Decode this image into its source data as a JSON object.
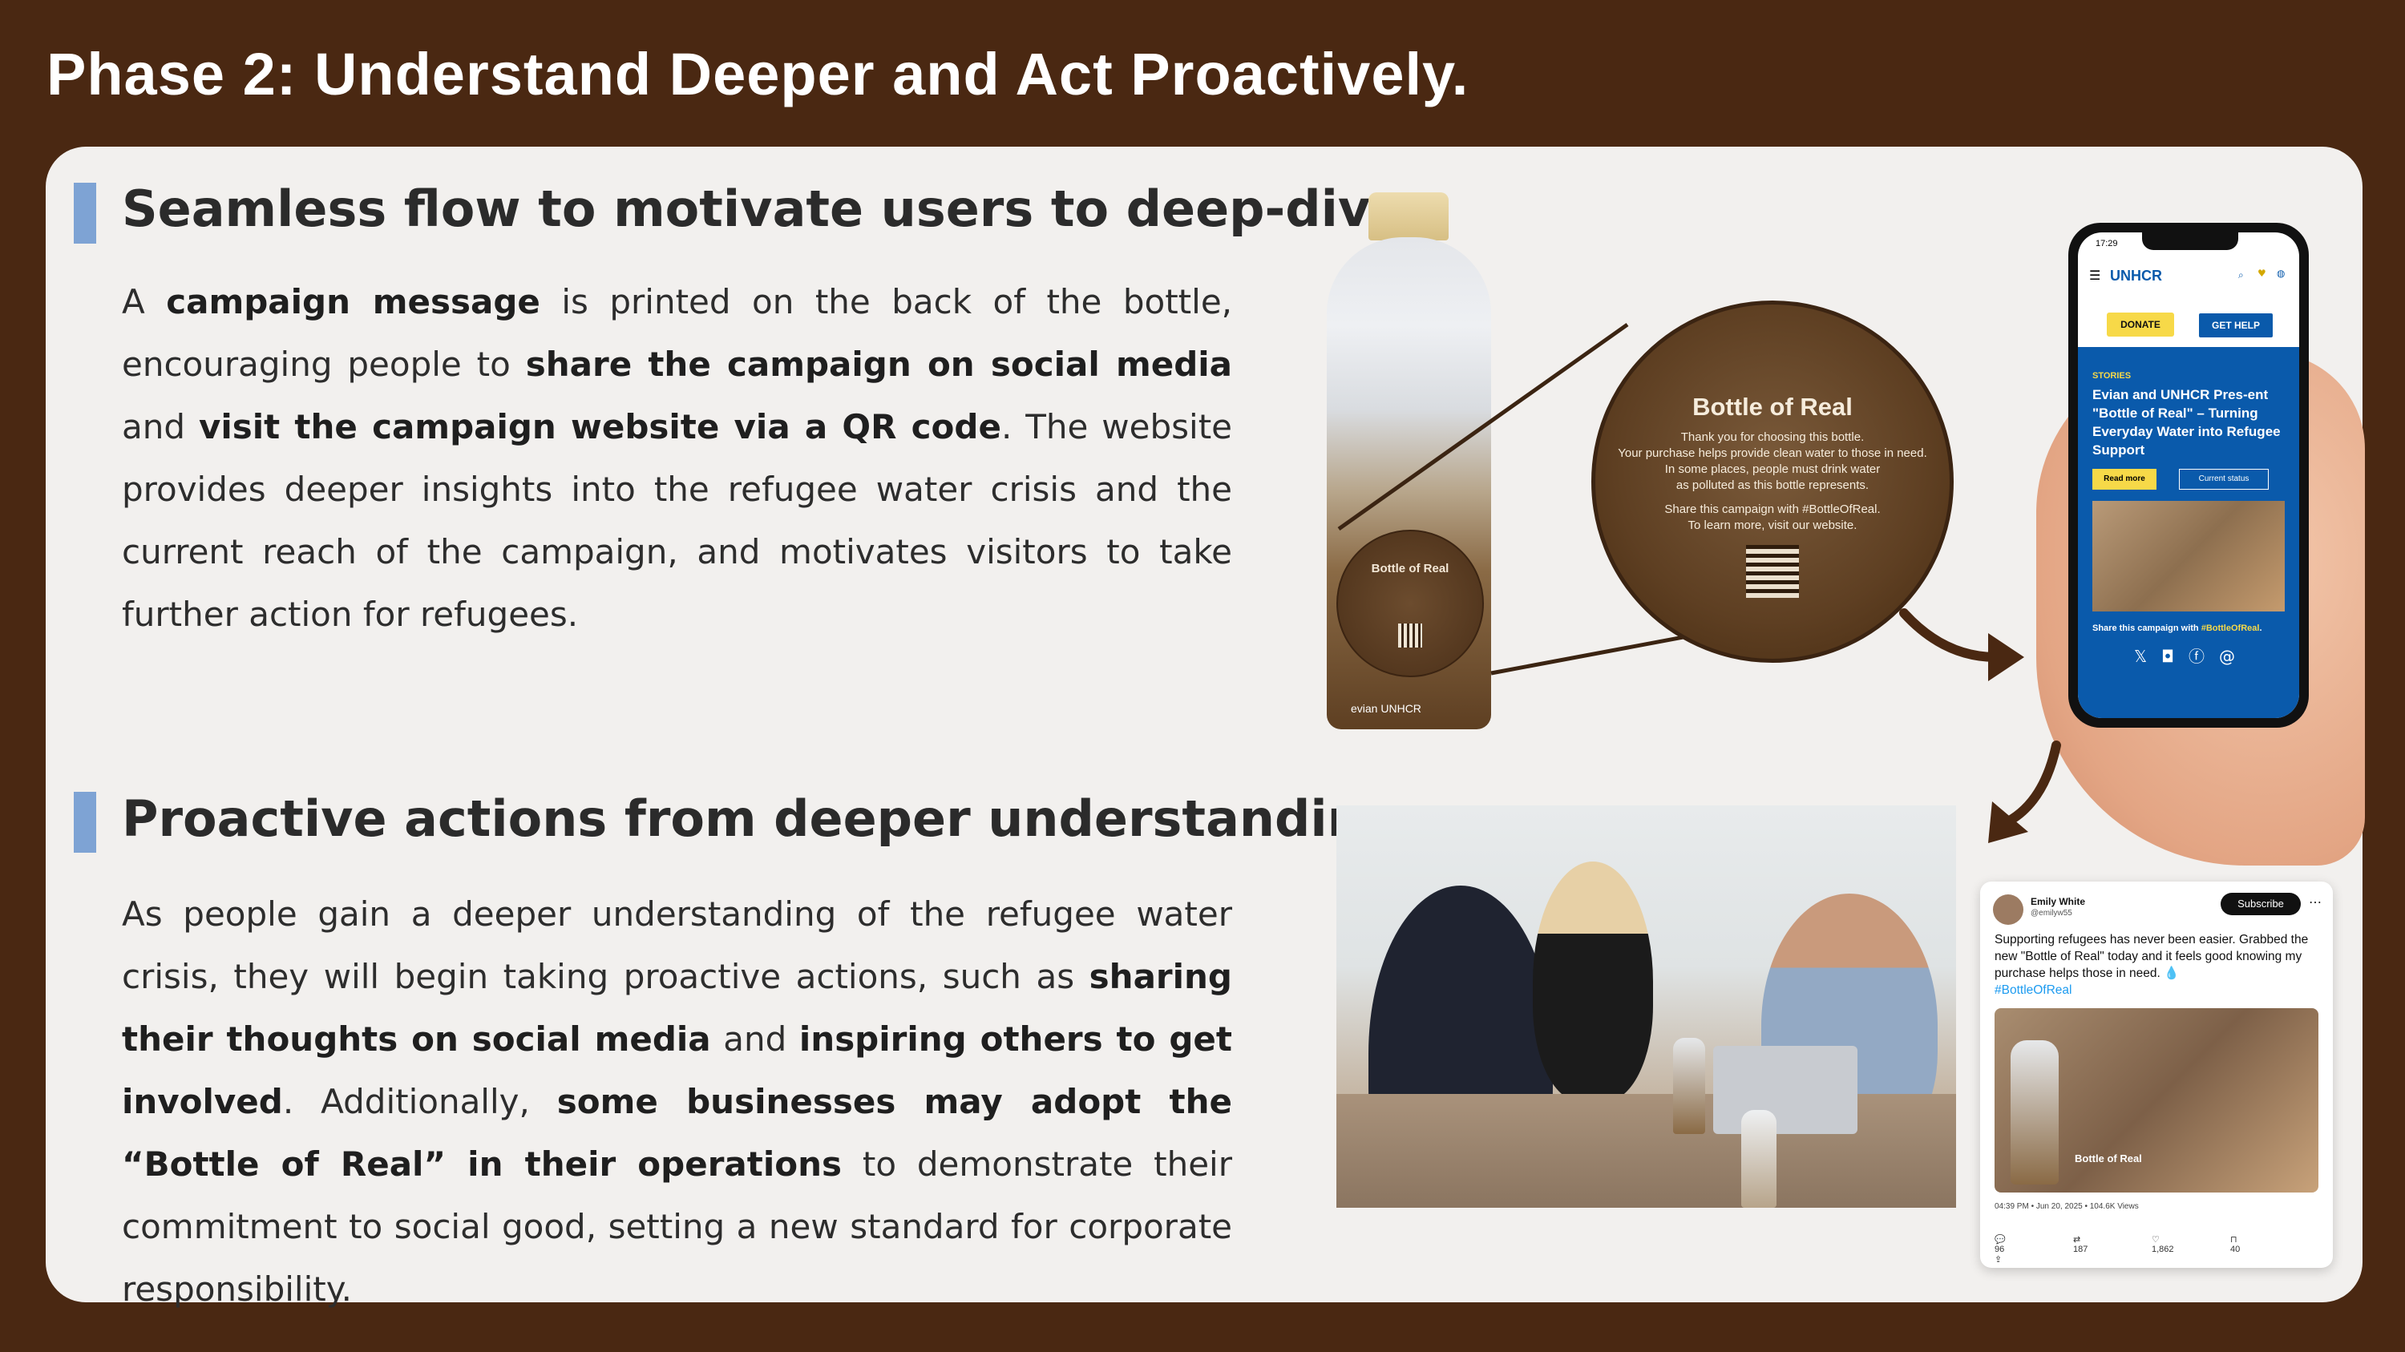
{
  "title": "Phase 2: Understand Deeper and Act Proactively.",
  "section1": {
    "title": "Seamless flow to motivate users to deep-dive",
    "body": [
      {
        "text": "A ",
        "bold": false
      },
      {
        "text": "campaign message",
        "bold": true
      },
      {
        "text": " is printed on the back of the bottle, encouraging people to ",
        "bold": false
      },
      {
        "text": "share the campaign on social media",
        "bold": true
      },
      {
        "text": " and ",
        "bold": false
      },
      {
        "text": "visit the campaign website via a QR code",
        "bold": true
      },
      {
        "text": ". The website provides deeper insights into the refugee water crisis and the current reach of the campaign, and motivates visitors to take further action for refugees.",
        "bold": false
      }
    ]
  },
  "section2": {
    "title": "Proactive actions from deeper understanding",
    "body": [
      {
        "text": "As people gain a deeper understanding of the refugee water crisis, they will begin taking proactive actions, such as ",
        "bold": false
      },
      {
        "text": "sharing their thoughts on social media",
        "bold": true
      },
      {
        "text": " and ",
        "bold": false
      },
      {
        "text": "inspiring others to get involved",
        "bold": true
      },
      {
        "text": ". Additionally, ",
        "bold": false
      },
      {
        "text": "some businesses may adopt the “Bottle of Real” in their operations",
        "bold": true
      },
      {
        "text": " to demonstrate their commitment to social good, setting a new standard for corporate responsibility.",
        "bold": false
      }
    ]
  },
  "bottle": {
    "label_title": "Bottle of Real",
    "brand": "evian  UNHCR"
  },
  "zoom_label": {
    "title": "Bottle of Real",
    "lines": [
      "Thank you for choosing this bottle.",
      "Your purchase helps provide clean water to those in need.",
      "In some places, people must drink water",
      "as polluted as this bottle represents.",
      "",
      "Share this campaign with #BottleOfReal.",
      "To learn more, visit our website."
    ]
  },
  "phone": {
    "time": "17:29",
    "logo": "UNHCR",
    "donate": "DONATE",
    "get_help": "GET HELP",
    "section": "STORIES",
    "headline": "Evian and UNHCR Pres-ent \"Bottle of Real\" – Turning Everyday Water into Refugee Support",
    "read_more": "Read more",
    "current_status": "Current status",
    "share_prefix": "Share this campaign with ",
    "share_tag": "#BottleOfReal",
    "share_suffix": ".",
    "social_icons": [
      "x-icon",
      "instagram-icon",
      "facebook-icon",
      "threads-icon"
    ]
  },
  "tweet": {
    "name": "Emily White",
    "handle": "@emilyw55",
    "subscribe": "Subscribe",
    "text": "Supporting refugees has never been easier. Grabbed the new \"Bottle of Real\" today and it feels good knowing my purchase helps those in need. 💧",
    "hashtag": "#BottleOfReal",
    "image_label": "Bottle of Real",
    "meta": "04:39 PM • Jun 20, 2025 • 104.6K Views",
    "replies": "96",
    "reposts": "187",
    "likes": "1,862",
    "bookmarks": "40"
  },
  "colors": {
    "background": "#4a2812",
    "panel": "#f2f0ee",
    "accent_bar": "#7ea3d4",
    "unhcr_blue": "#0a5aab",
    "unhcr_yellow": "#f7d948"
  }
}
